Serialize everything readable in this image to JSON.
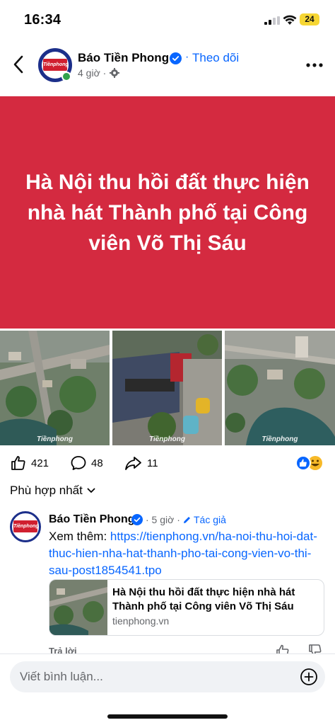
{
  "status_bar": {
    "time": "16:34",
    "battery": "24"
  },
  "header": {
    "page_name": "Báo Tiền Phong",
    "separator": "·",
    "follow_label": "Theo dõi",
    "post_time": "4 giờ ·",
    "logo_text": "Tiềnphong"
  },
  "banner": {
    "title": "Hà Nội thu hồi đất thực hiện nhà hát Thành phố tại Công viên Võ Thị Sáu"
  },
  "photos": {
    "watermark": "Tiềnphong"
  },
  "reactions": {
    "likes": "421",
    "comments": "48",
    "shares": "11"
  },
  "sort": {
    "label": "Phù hợp nhất"
  },
  "comment": {
    "author": "Báo Tiền Phong",
    "time": "· 5 giờ ·",
    "author_badge": "Tác giả",
    "prefix": "Xem thêm: ",
    "link": "https://tienphong.vn/ha-noi-thu-hoi-dat-thuc-hien-nha-hat-thanh-pho-tai-cong-vien-vo-thi-sau-post1854541.tpo",
    "card_title": "Hà Nội thu hồi đất thực hiện nhà hát Thành phố tại Công viên Võ Thị Sáu",
    "card_domain": "tienphong.vn",
    "reply_label": "Trả lời"
  },
  "composer": {
    "placeholder": "Viết bình luận..."
  },
  "colors": {
    "brand_blue": "#0866ff",
    "banner_red": "#d42a40",
    "logo_red": "#d01f2f"
  }
}
